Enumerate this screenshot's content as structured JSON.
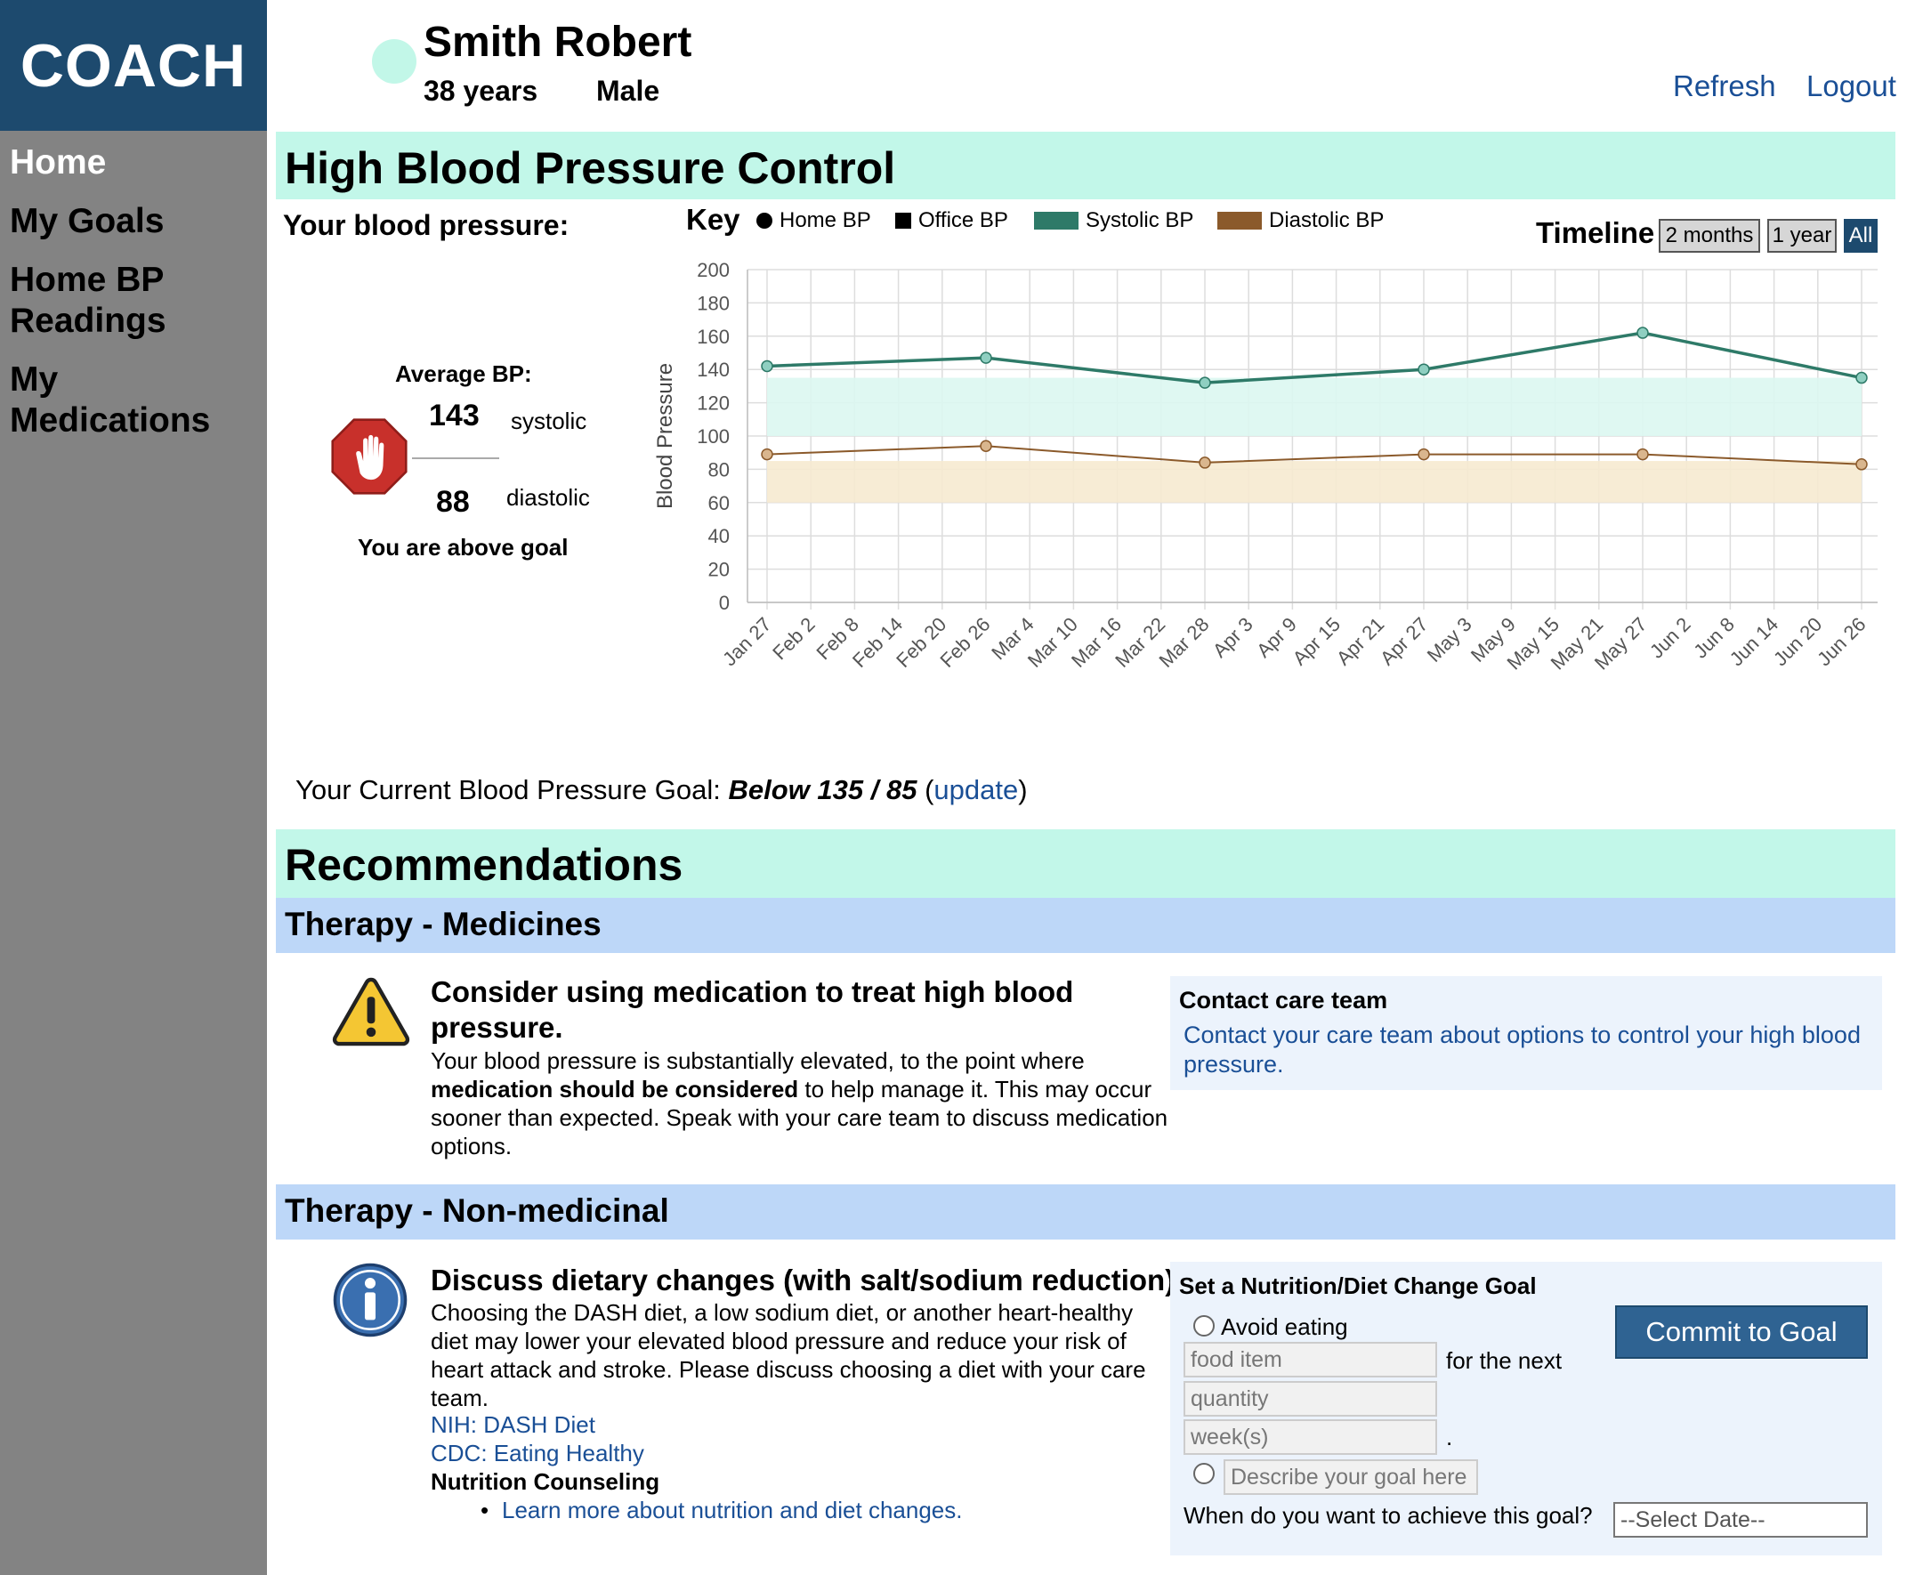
{
  "app": {
    "logo": "COACH"
  },
  "nav": {
    "items": [
      "Home",
      "My Goals",
      "Home BP Readings",
      "My Medications"
    ]
  },
  "patient": {
    "name": "Smith Robert",
    "age": "38 years",
    "sex": "Male"
  },
  "header": {
    "refresh": "Refresh",
    "logout": "Logout"
  },
  "bp": {
    "title": "High Blood Pressure Control",
    "your_bp": "Your blood pressure:",
    "average_label": "Average BP:",
    "systolic_value": "143",
    "systolic_label": "systolic",
    "diastolic_value": "88",
    "diastolic_label": "diastolic",
    "status": "You are above goal"
  },
  "key": {
    "label": "Key",
    "home_bp": "Home BP",
    "office_bp": "Office BP",
    "systolic_bp": "Systolic BP",
    "diastolic_bp": "Diastolic BP"
  },
  "timeline": {
    "label": "Timeline",
    "buttons": [
      "2 months",
      "1 year",
      "All"
    ],
    "active": "All"
  },
  "colors": {
    "systolic": "#2e7a68",
    "diastolic": "#8b5a2b",
    "systolic_band": "#dcf7f1",
    "diastolic_band": "#f6ead0",
    "accent": "#1d4a6e",
    "mint": "#c2f7e9",
    "section_blue": "#bdd7f8"
  },
  "chart_data": {
    "type": "line",
    "ylabel": "Blood Pressure",
    "ylim": [
      0,
      200
    ],
    "yticks": [
      0,
      20,
      40,
      60,
      80,
      100,
      120,
      140,
      160,
      180,
      200
    ],
    "xticks": [
      "Jan 27",
      "Feb 2",
      "Feb 8",
      "Feb 14",
      "Feb 20",
      "Feb 26",
      "Mar 4",
      "Mar 10",
      "Mar 16",
      "Mar 22",
      "Mar 28",
      "Apr 3",
      "Apr 9",
      "Apr 15",
      "Apr 21",
      "Apr 27",
      "May 3",
      "May 9",
      "May 15",
      "May 21",
      "May 27",
      "Jun 2",
      "Jun 8",
      "Jun 14",
      "Jun 20",
      "Jun 26"
    ],
    "grid": true,
    "goal_bands": [
      {
        "name": "Systolic BP",
        "from": 100,
        "to": 135
      },
      {
        "name": "Diastolic BP",
        "from": 60,
        "to": 85
      }
    ],
    "series": [
      {
        "name": "Systolic BP",
        "x": [
          "Jan 27",
          "Feb 26",
          "Mar 28",
          "Apr 27",
          "May 27",
          "Jun 26"
        ],
        "values": [
          142,
          147,
          132,
          140,
          162,
          135
        ]
      },
      {
        "name": "Diastolic BP",
        "x": [
          "Jan 27",
          "Feb 26",
          "Mar 28",
          "Apr 27",
          "May 27",
          "Jun 26"
        ],
        "values": [
          89,
          94,
          84,
          89,
          89,
          83
        ]
      }
    ]
  },
  "goal": {
    "prefix": "Your Current Blood Pressure Goal:",
    "value": "Below 135 / 85",
    "open_paren": "(",
    "update": "update",
    "close_paren": ")"
  },
  "recommendations": {
    "title": "Recommendations",
    "medicines": {
      "section": "Therapy - Medicines",
      "heading": "Consider using medication to treat high blood pressure.",
      "body_1": "Your blood pressure is substantially elevated, to the point where",
      "body_bold": "medication should be considered",
      "body_2": " to help manage it. This may occur sooner than expected. Speak with your care team to discuss medication options.",
      "contact_title": "Contact care team",
      "contact_link": "Contact your care team about options to control your high blood pressure."
    },
    "non_medicinal": {
      "section": "Therapy - Non-medicinal",
      "heading": "Discuss dietary changes (with salt/sodium reduction).",
      "body": "Choosing the DASH diet, a low sodium diet, or another heart-healthy diet may lower your elevated blood pressure and reduce your risk of heart attack and stroke. Please discuss choosing a diet with your care team.",
      "link_nih": "NIH: DASH Diet",
      "link_cdc": "CDC: Eating Healthy",
      "counseling_label": "Nutrition Counseling",
      "counseling_link": "Learn more about nutrition and diet changes."
    }
  },
  "diet_goal": {
    "title": "Set a Nutrition/Diet Change Goal",
    "avoid_label": "Avoid eating",
    "food_placeholder": "food item",
    "next_label": "for the next",
    "quantity_placeholder": "quantity",
    "period_placeholder": "week(s)",
    "period_end": ".",
    "describe_placeholder": "Describe your goal here",
    "commit": "Commit to Goal",
    "achieve_label": "When do you want to achieve this goal?",
    "date_select": "--Select Date--"
  }
}
